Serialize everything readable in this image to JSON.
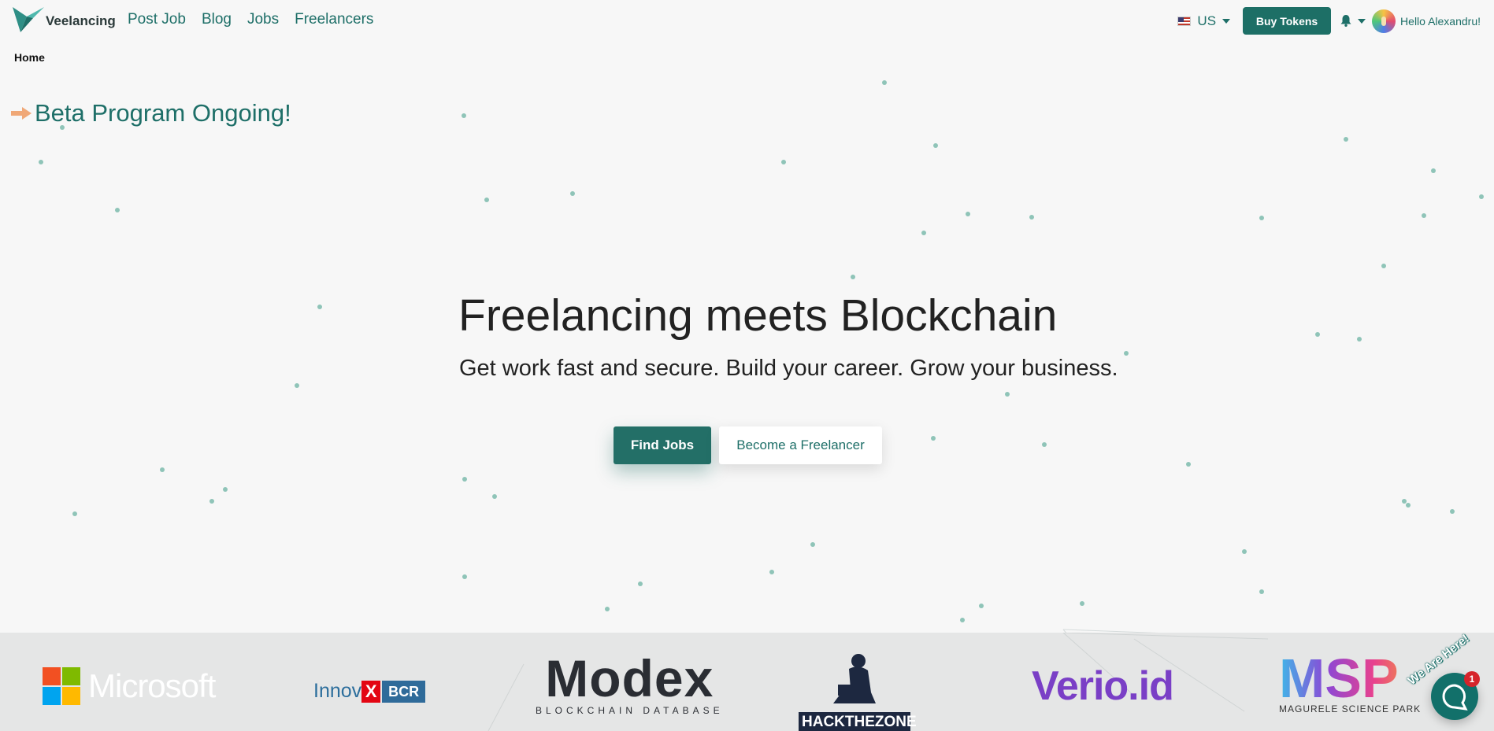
{
  "nav": {
    "brand": "Veelancing",
    "links": [
      "Post Job",
      "Blog",
      "Jobs",
      "Freelancers"
    ],
    "locale": "US",
    "buy_tokens": "Buy Tokens",
    "greeting": "Hello Alexandru!"
  },
  "breadcrumb": "Home",
  "banner": {
    "text": "Beta Program Ongoing!"
  },
  "hero": {
    "title": "Freelancing meets Blockchain",
    "subtitle": "Get work fast and secure. Build your career. Grow your business.",
    "primary_cta": "Find Jobs",
    "secondary_cta": "Become a Freelancer"
  },
  "partners": {
    "microsoft": "Microsoft",
    "innov": "Innov",
    "innov_x": "X",
    "bcr": "BCR",
    "modex": "Modex",
    "modex_sub": "BLOCKCHAIN DATABASE",
    "hackthezone": "HACKTHEZONE",
    "verio": "Verio.id",
    "msp": "MSP",
    "msp_sub": "MAGURELE SCIENCE PARK"
  },
  "chat": {
    "badge": "1",
    "tagline": "We Are Here!"
  },
  "colors": {
    "brand": "#1e6f68",
    "button": "#1d6f66",
    "background": "#f7f7f7",
    "partners_bg": "#e5e6e6",
    "chat_badge": "#d6242a",
    "arrow": "#f0a877"
  },
  "icons": {
    "logo": "veelancing-bird-logo",
    "flag": "us-flag",
    "bell": "bell-icon",
    "arrow": "right-arrow-icon",
    "chat": "chat-bubble-icon"
  }
}
